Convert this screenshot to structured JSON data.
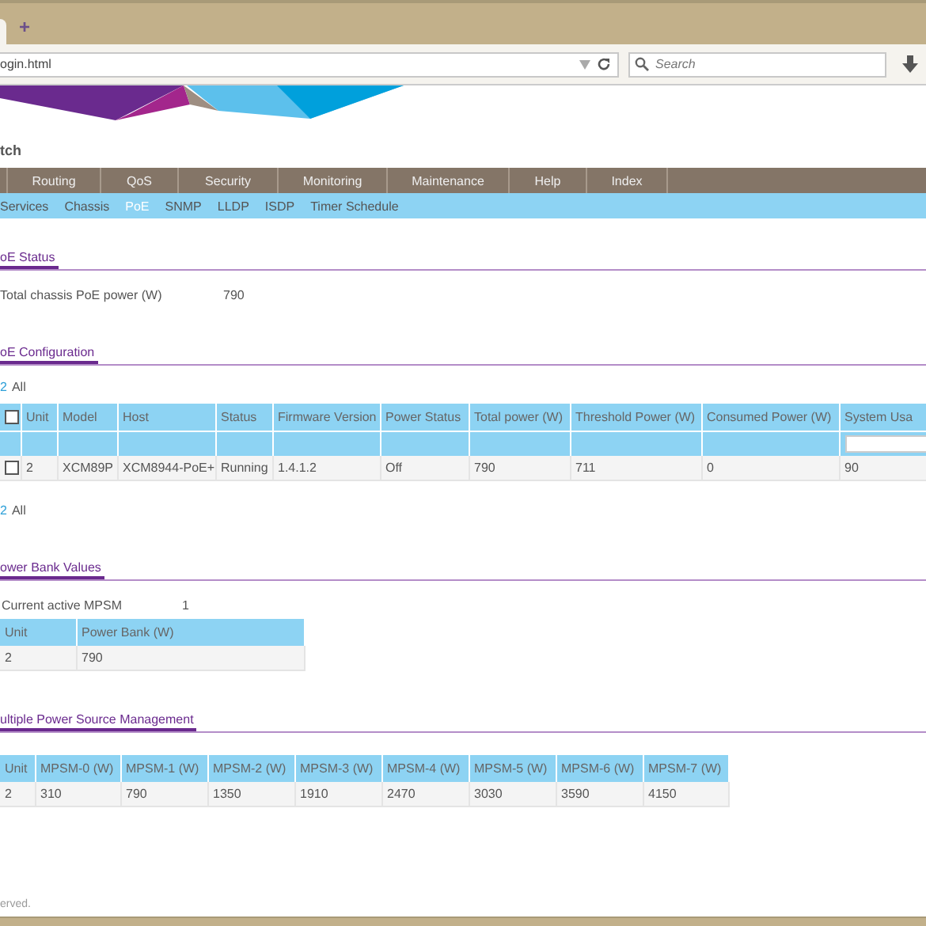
{
  "browser": {
    "new_tab": "+",
    "address": "ogin.html",
    "search": {
      "placeholder": "Search"
    }
  },
  "app_title": "tch",
  "main_nav": [
    {
      "label": "Routing",
      "selected": false
    },
    {
      "label": "QoS",
      "selected": false
    },
    {
      "label": "Security",
      "selected": false
    },
    {
      "label": "Monitoring",
      "selected": false
    },
    {
      "label": "Maintenance",
      "selected": false
    },
    {
      "label": "Help",
      "selected": false
    },
    {
      "label": "Index",
      "selected": false
    }
  ],
  "sub_nav": [
    {
      "label": "Services",
      "selected": false
    },
    {
      "label": "Chassis",
      "selected": false
    },
    {
      "label": "PoE",
      "selected": true
    },
    {
      "label": "SNMP",
      "selected": false
    },
    {
      "label": "LLDP",
      "selected": false
    },
    {
      "label": "ISDP",
      "selected": false
    },
    {
      "label": "Timer Schedule",
      "selected": false
    }
  ],
  "poe_status": {
    "title": "oE Status",
    "label": "Total chassis PoE power (W)",
    "value": "790"
  },
  "poe_config": {
    "title": "oE Configuration",
    "pager_top": {
      "page": "2",
      "all": "All"
    },
    "pager_bottom": {
      "page": "2",
      "all": "All"
    },
    "header_checked": false,
    "columns": [
      "Unit",
      "Model",
      "Host",
      "Status",
      "Firmware Version",
      "Power Status",
      "Total power (W)",
      "Threshold Power (W)",
      "Consumed Power (W)",
      "System Usa"
    ],
    "rows": [
      {
        "checked": false,
        "cells": [
          "2",
          "XCM89P",
          "XCM8944-PoE+",
          "Running",
          "1.4.1.2",
          "Off",
          "790",
          "711",
          "0",
          "90"
        ]
      }
    ]
  },
  "power_bank": {
    "title": "ower Bank Values",
    "label": "Current active MPSM",
    "value": "1",
    "columns": [
      "Unit",
      "Power Bank (W)"
    ],
    "rows": [
      [
        "2",
        "790"
      ]
    ]
  },
  "mpsm": {
    "title": "ultiple Power Source Management",
    "columns": [
      "Unit",
      "MPSM-0 (W)",
      "MPSM-1 (W)",
      "MPSM-2 (W)",
      "MPSM-3 (W)",
      "MPSM-4 (W)",
      "MPSM-5 (W)",
      "MPSM-6 (W)",
      "MPSM-7 (W)"
    ],
    "rows": [
      [
        "2",
        "310",
        "790",
        "1350",
        "1910",
        "2470",
        "3030",
        "3590",
        "4150"
      ]
    ]
  },
  "footer": "erved."
}
